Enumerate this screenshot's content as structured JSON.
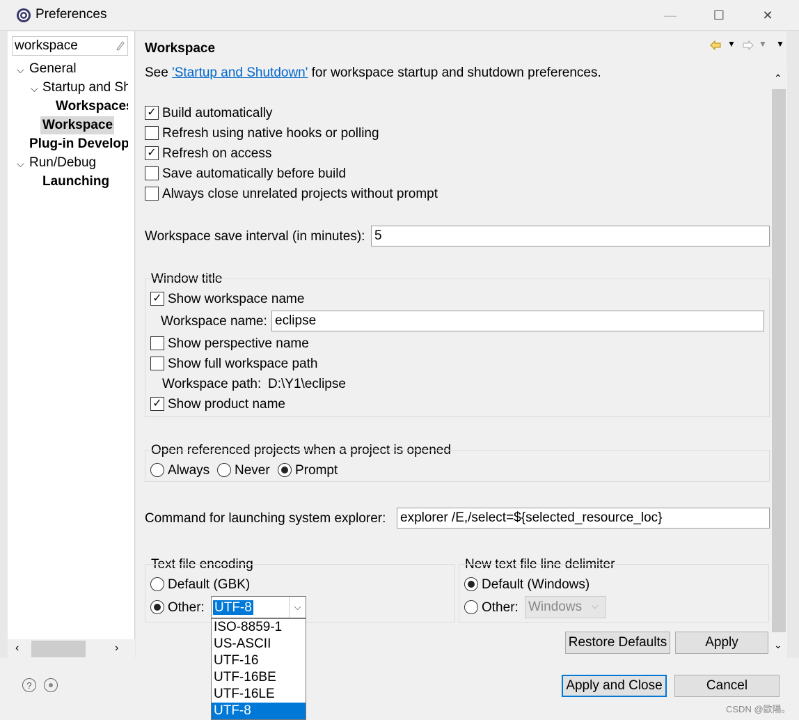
{
  "window": {
    "title": "Preferences",
    "minimize_glyph": "—",
    "maximize_glyph": "☐",
    "close_glyph": "✕"
  },
  "filter": {
    "value": "workspace"
  },
  "tree": {
    "general": "General",
    "startup": "Startup and Sh",
    "workspaces": "Workspaces",
    "workspace": "Workspace",
    "plugin": "Plug-in Develop",
    "rundebug": "Run/Debug",
    "launching": "Launching"
  },
  "page": {
    "title": "Workspace",
    "see_prefix": "See ",
    "see_link": "'Startup and Shutdown'",
    "see_suffix": " for workspace startup and shutdown preferences."
  },
  "options": {
    "build_auto": {
      "label": "Build automatically",
      "checked": true
    },
    "refresh_native": {
      "label": "Refresh using native hooks or polling",
      "checked": false
    },
    "refresh_access": {
      "label": "Refresh on access",
      "checked": true
    },
    "save_auto": {
      "label": "Save automatically before build",
      "checked": false
    },
    "close_unrelated": {
      "label": "Always close unrelated projects without prompt",
      "checked": false
    }
  },
  "save_interval": {
    "label": "Workspace save interval (in minutes):",
    "value": "5"
  },
  "window_title": {
    "legend": "Window title",
    "show_ws_name": {
      "label": "Show workspace name",
      "checked": true
    },
    "ws_name_label": "Workspace name:",
    "ws_name_value": "eclipse",
    "show_perspective": {
      "label": "Show perspective name",
      "checked": false
    },
    "show_full_path": {
      "label": "Show full workspace path",
      "checked": false
    },
    "ws_path_label": "Workspace path:",
    "ws_path_value": "D:\\Y1\\eclipse",
    "show_product": {
      "label": "Show product name",
      "checked": true
    }
  },
  "open_referenced": {
    "legend": "Open referenced projects when a project is opened",
    "always": "Always",
    "never": "Never",
    "prompt": "Prompt",
    "selected": "prompt"
  },
  "explorer": {
    "label": "Command for launching system explorer:",
    "value": "explorer /E,/select=${selected_resource_loc}"
  },
  "encoding": {
    "legend": "Text file encoding",
    "default": "Default (GBK)",
    "other": "Other:",
    "value": "UTF-8",
    "options": [
      "ISO-8859-1",
      "US-ASCII",
      "UTF-16",
      "UTF-16BE",
      "UTF-16LE",
      "UTF-8"
    ]
  },
  "line_delim": {
    "legend": "New text file line delimiter",
    "default": "Default (Windows)",
    "other": "Other:",
    "value": "Windows"
  },
  "buttons": {
    "restore": "Restore Defaults",
    "apply": "Apply",
    "apply_close": "Apply and Close",
    "cancel": "Cancel"
  },
  "watermark": "CSDN @歐陽。"
}
